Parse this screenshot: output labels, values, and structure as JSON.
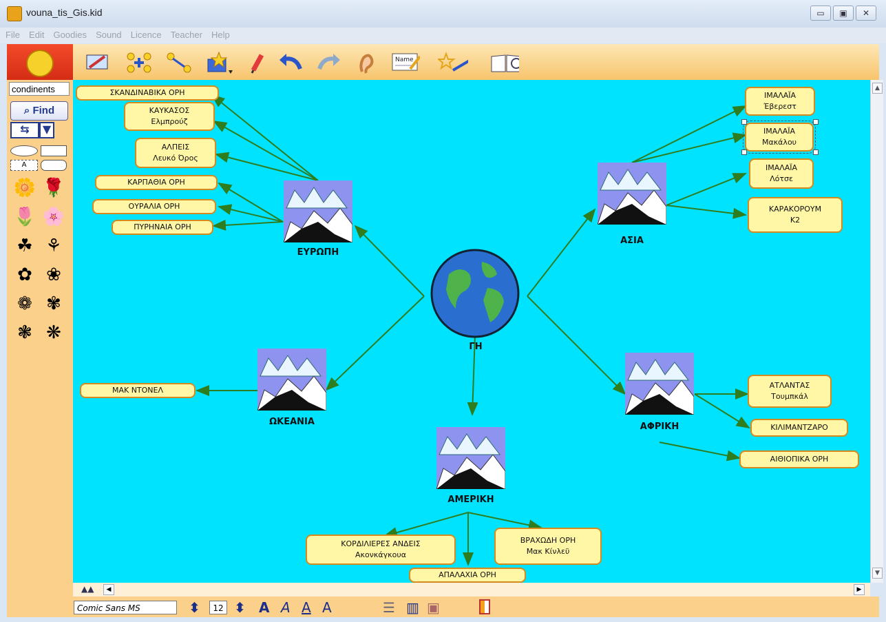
{
  "window": {
    "title": "vouna_tis_Gis.kid",
    "buttons": [
      "▭",
      "▣",
      "✕"
    ]
  },
  "menu": [
    "File",
    "Edit",
    "Goodies",
    "Sound",
    "Licence",
    "Teacher",
    "Help"
  ],
  "toolbar": {
    "icons": [
      "note-pencil-icon",
      "new-subidea-icon",
      "link-arrow-icon",
      "symbols-box-icon",
      "pencil-icon",
      "undo-icon",
      "redo-icon",
      "listen-ear-icon",
      "name-card-icon",
      "magic-wand-icon",
      "reading-book-icon"
    ]
  },
  "sidebar": {
    "search_value": "condinents",
    "find_label": "Find",
    "shape_text_label": "A"
  },
  "map": {
    "center": {
      "label": "ΓΗ"
    },
    "hubs": {
      "europe": "ΕΥΡΩΠΗ",
      "asia": "ΑΣΙΑ",
      "oceania": "ΩΚΕΑΝΙΑ",
      "africa": "ΑΦΡΙΚΗ",
      "america": "ΑΜΕΡΙΚΗ"
    },
    "europe_nodes": [
      {
        "title": "ΣΚΑΝΔΙΝΑΒΙΚΑ ΟΡΗ",
        "sub": ""
      },
      {
        "title": "ΚΑΥΚΑΣΟΣ",
        "sub": "Ελμπρούζ"
      },
      {
        "title": "ΑΛΠΕΙΣ",
        "sub": "Λευκό Όρος"
      },
      {
        "title": "ΚΑΡΠΑΘΙΑ ΟΡΗ",
        "sub": ""
      },
      {
        "title": "ΟΥΡΑΛΙΑ ΟΡΗ",
        "sub": ""
      },
      {
        "title": "ΠΥΡΗΝΑΙΑ ΟΡΗ",
        "sub": ""
      }
    ],
    "asia_nodes": [
      {
        "title": "ΙΜΑΛΑΪΑ",
        "sub": "Έβερεστ"
      },
      {
        "title": "ΙΜΑΛΑΪΑ",
        "sub": "Μακάλου"
      },
      {
        "title": "ΙΜΑΛΑΪΑ",
        "sub": "Λότσε"
      },
      {
        "title": "ΚΑΡΑΚΟΡΟΥΜ",
        "sub": "Κ2"
      }
    ],
    "oceania_nodes": [
      {
        "title": "ΜΑΚ ΝΤΟΝΕΛ",
        "sub": ""
      }
    ],
    "africa_nodes": [
      {
        "title": "ΑΤΛΑΝΤΑΣ",
        "sub": "Τουμπκάλ"
      },
      {
        "title": "ΚΙΛΙΜΑΝΤΖΑΡΟ",
        "sub": ""
      },
      {
        "title": "ΑΙΘΙΟΠΙΚΑ ΟΡΗ",
        "sub": ""
      }
    ],
    "america_nodes": [
      {
        "title": "ΚΟΡΔΙΛΙΕΡΕΣ ΑΝΔΕΙΣ",
        "sub": "Ακονκάγκουα"
      },
      {
        "title": "ΑΠΑΛΑΧΙΑ ΟΡΗ",
        "sub": ""
      },
      {
        "title": "ΒΡΑΧΩΔΗ ΟΡΗ",
        "sub": "Μακ Κίνλεϋ"
      }
    ]
  },
  "statusbar": {
    "font_name": "Comic Sans MS",
    "font_size": "12"
  },
  "colors": {
    "canvas": "#00e3ff",
    "node_fill": "#fff6a6",
    "node_border": "#d48a1d",
    "arrow": "#2e7d1e"
  }
}
